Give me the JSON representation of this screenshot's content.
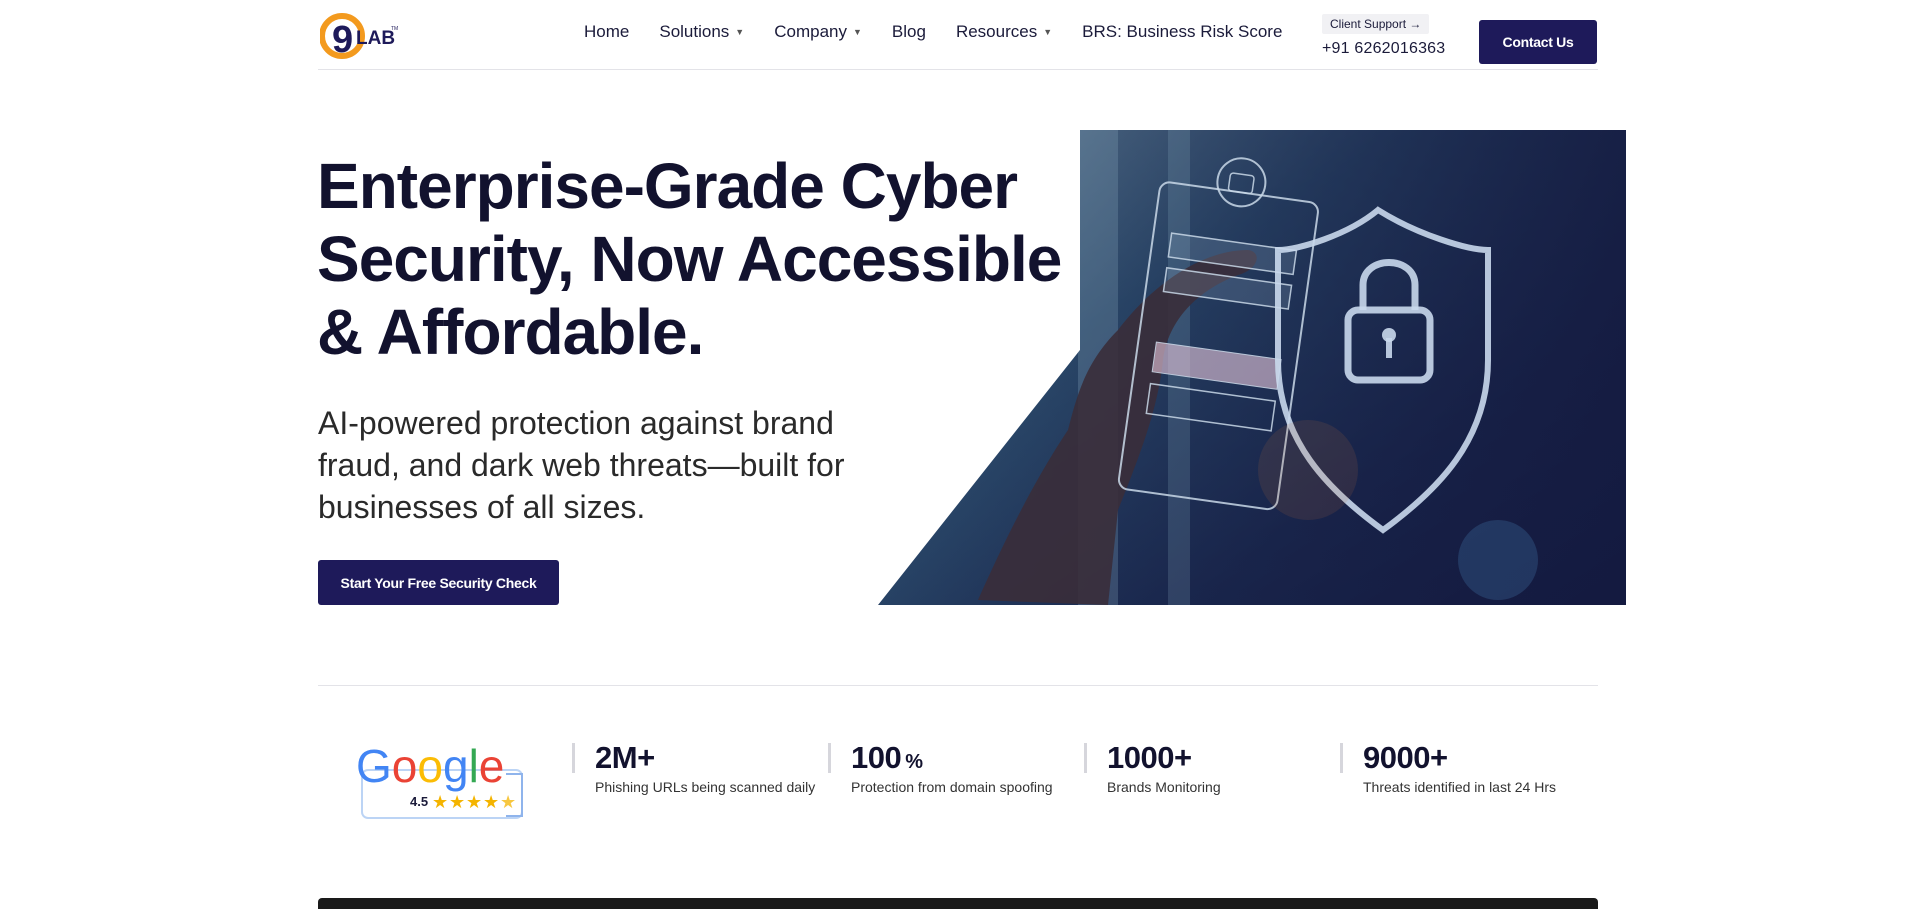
{
  "header": {
    "logo_text": "9LAB",
    "nav": [
      {
        "label": "Home",
        "dropdown": false
      },
      {
        "label": "Solutions",
        "dropdown": true
      },
      {
        "label": "Company",
        "dropdown": true
      },
      {
        "label": "Blog",
        "dropdown": false
      },
      {
        "label": "Resources",
        "dropdown": true
      },
      {
        "label": "BRS: Business Risk Score",
        "dropdown": false
      }
    ],
    "support_label": "Client Support →",
    "support_phone": "+91 6262016363",
    "contact_label": "Contact Us"
  },
  "hero": {
    "title": "Enterprise-Grade Cyber Security, Now Accessible & Affordable.",
    "subtitle": "AI-powered protection against brand fraud, and dark web threats—built for businesses of all sizes.",
    "cta_label": "Start Your Free Security Check"
  },
  "google": {
    "brand": "Google",
    "rating": "4.5",
    "stars": 4.5
  },
  "stats": [
    {
      "value": "2M+",
      "suffix": "",
      "label": "Phishing URLs being scanned daily"
    },
    {
      "value": "100",
      "suffix": "%",
      "label": "Protection from domain spoofing"
    },
    {
      "value": "1000+",
      "suffix": "",
      "label": "Brands Monitoring"
    },
    {
      "value": "9000+",
      "suffix": "",
      "label": "Threats identified in last 24 Hrs"
    }
  ],
  "colors": {
    "primary": "#1e1a5a",
    "heading": "#12122e",
    "logo_orange": "#f39a1e",
    "logo_dark": "#1e1a5a"
  }
}
